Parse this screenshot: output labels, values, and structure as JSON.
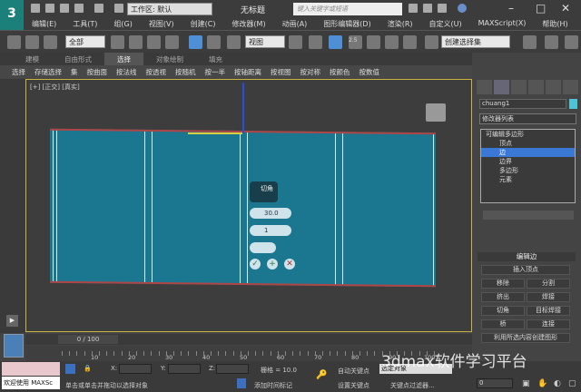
{
  "titlebar": {
    "title": "无标题",
    "workspace": "工作区: 默认",
    "search_placeholder": "键入关键字或短语"
  },
  "menu": [
    "编辑(E)",
    "工具(T)",
    "组(G)",
    "视图(V)",
    "创建(C)",
    "修改器(M)",
    "动画(A)",
    "图形编辑器(D)",
    "渲染(R)",
    "自定义(U)",
    "MAXScript(X)",
    "帮助(H)"
  ],
  "toolbar": {
    "selection_filter": "全部",
    "ref_coord": "视图",
    "named_selection": "创建选择集",
    "snap_angle": "2.5"
  },
  "ribbon": {
    "tabs": [
      "建模",
      "自由形式",
      "选择",
      "对象绘制",
      "填充"
    ],
    "active_tab": "选择",
    "items": [
      "选择",
      "存储选择",
      "集",
      "按曲面",
      "按法线",
      "按透视",
      "按随机",
      "按一半",
      "按轴距离",
      "按视图",
      "按对称",
      "按颜色",
      "按数值"
    ]
  },
  "viewport": {
    "label": "[+] [正交] [真实]",
    "caddy": {
      "title": "切角",
      "amount": "30.0",
      "segments": "1"
    }
  },
  "panel": {
    "object_name": "chuang1",
    "object_color": "#4ec3d8",
    "modifier_list": "修改器列表",
    "stack": [
      {
        "label": "可编辑多边形"
      },
      {
        "label": "顶点"
      },
      {
        "label": "边"
      },
      {
        "label": "边界"
      },
      {
        "label": "多边形"
      },
      {
        "label": "元素"
      }
    ],
    "selected": "边",
    "rollout": {
      "title": "编辑边",
      "insert_vertex": "插入顶点",
      "remove": "移除",
      "split": "分割",
      "extrude": "挤出",
      "weld": "焊接",
      "chamfer": "切角",
      "target_weld": "目标焊接",
      "bridge": "桥",
      "connect": "连接",
      "create_shape": "利用所选内容创建图形"
    }
  },
  "timeline": {
    "frame": "0 / 100",
    "ticks": [
      "10",
      "20",
      "30",
      "40",
      "50",
      "60",
      "70",
      "80",
      "90",
      "100"
    ]
  },
  "status": {
    "welcome": "欢迎使用 MAXSc",
    "prompt": "单击或单击并拖动以选择对象",
    "x_label": "X:",
    "y_label": "Y:",
    "z_label": "Z:",
    "grid": "栅格 = 10.0",
    "auto_key": "自动关键点",
    "set_key": "设置关键点",
    "selected_obj": "选定对象",
    "key_filters": "关键点过滤器...",
    "add_time_tag": "添加时间标记",
    "frame_value": "0"
  },
  "watermark": "3dmax软件学习平台"
}
